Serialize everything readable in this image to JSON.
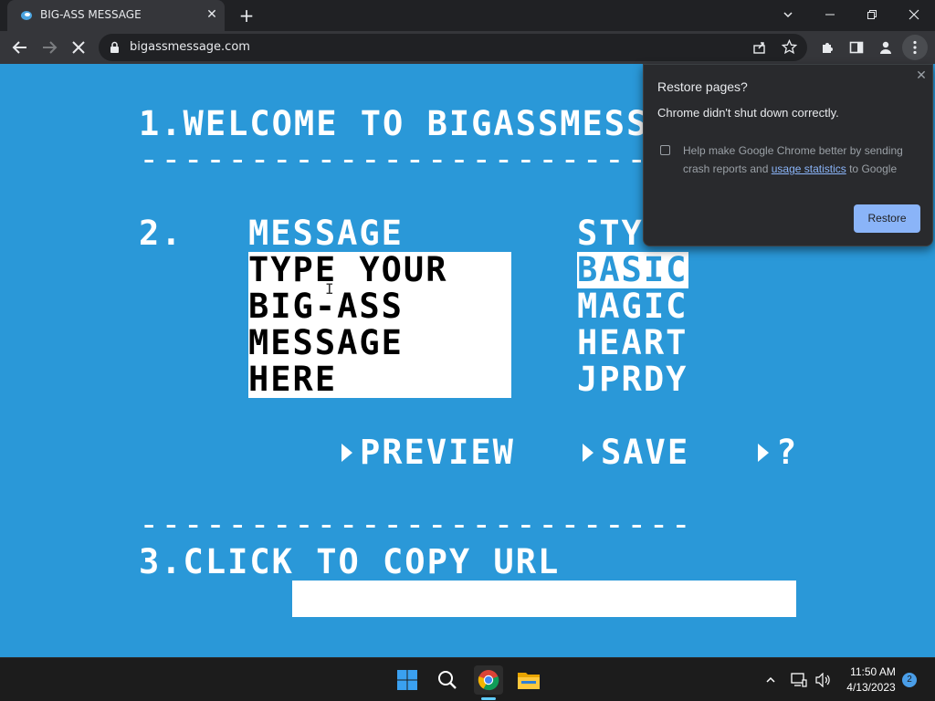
{
  "browser": {
    "tab_title": "BIG-ASS MESSAGE",
    "url": "bigassmessage.com"
  },
  "page": {
    "step1": "1.WELCOME TO BIGASSMESS",
    "step2_number": "2.",
    "message_heading": "MESSAGE",
    "message_placeholder": "TYPE YOUR BIG-ASS MESSAGE HERE",
    "style_heading": "STY",
    "styles": [
      "BASIC",
      "MAGIC",
      "HEART",
      "JPRDY"
    ],
    "selected_style": "BASIC",
    "actions": {
      "preview": "PREVIEW",
      "save": "SAVE",
      "help": "?"
    },
    "step3": "3.CLICK TO COPY URL",
    "url_value": ""
  },
  "popup": {
    "title": "Restore pages?",
    "message": "Chrome didn't shut down correctly.",
    "checkbox_text_before": "Help make Google Chrome better by sending crash reports and ",
    "checkbox_link": "usage statistics",
    "checkbox_text_after": " to Google",
    "restore_label": "Restore"
  },
  "taskbar": {
    "time": "11:50 AM",
    "date": "4/13/2023",
    "notification_count": "2"
  },
  "colors": {
    "page_bg": "#2a98d8",
    "accent": "#8ab4f8"
  }
}
